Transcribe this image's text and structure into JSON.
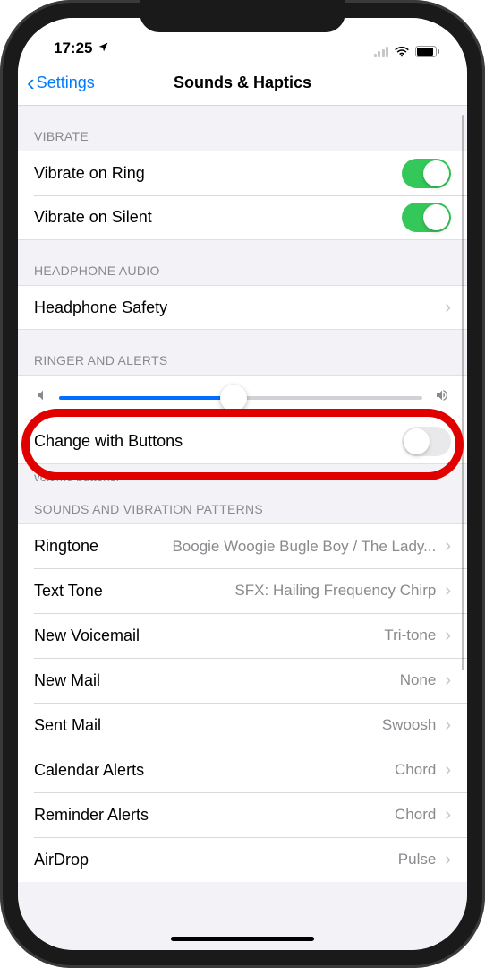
{
  "status": {
    "time": "17:25",
    "location_icon": "loc",
    "wifi": true,
    "battery_pct": 85
  },
  "nav": {
    "back_label": "Settings",
    "title": "Sounds & Haptics"
  },
  "sections": {
    "vibrate": {
      "header": "VIBRATE",
      "ring_label": "Vibrate on Ring",
      "ring_on": true,
      "silent_label": "Vibrate on Silent",
      "silent_on": true
    },
    "headphone": {
      "header": "HEADPHONE AUDIO",
      "safety_label": "Headphone Safety"
    },
    "ringer": {
      "header": "RINGER AND ALERTS",
      "slider_value": 0.48,
      "change_label": "Change with Buttons",
      "change_on": false,
      "footer": "volume buttons."
    },
    "patterns": {
      "header": "SOUNDS AND VIBRATION PATTERNS",
      "items": [
        {
          "label": "Ringtone",
          "value": "Boogie Woogie Bugle Boy / The Lady..."
        },
        {
          "label": "Text Tone",
          "value": "SFX: Hailing Frequency Chirp"
        },
        {
          "label": "New Voicemail",
          "value": "Tri-tone"
        },
        {
          "label": "New Mail",
          "value": "None"
        },
        {
          "label": "Sent Mail",
          "value": "Swoosh"
        },
        {
          "label": "Calendar Alerts",
          "value": "Chord"
        },
        {
          "label": "Reminder Alerts",
          "value": "Chord"
        },
        {
          "label": "AirDrop",
          "value": "Pulse"
        }
      ]
    }
  }
}
